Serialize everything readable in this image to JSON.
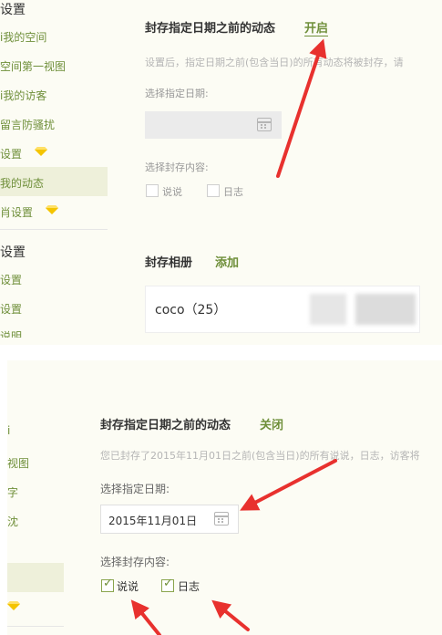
{
  "top": {
    "sidebar": {
      "header1": "设置",
      "items": [
        "i我的空间",
        "空间第一视图",
        "i我的访客",
        "留言防骚扰",
        "设置",
        "我的动态",
        "肖设置"
      ],
      "header2": "设置",
      "items2": [
        "设置",
        "设置",
        "说明"
      ]
    },
    "seal_title": "封存指定日期之前的动态",
    "toggle_label": "开启",
    "description": "设置后，指定日期之前(包含当日)的所有动态将被封存，请",
    "date_label": "选择指定日期:",
    "content_label": "选择封存内容:",
    "options": [
      "说说",
      "日志"
    ],
    "album_title": "封存相册",
    "album_add": "添加",
    "album_item": "coco（25）"
  },
  "bottom": {
    "sidebar": {
      "items": [
        "i",
        "视图",
        "字",
        "沈",
        "",
        ""
      ]
    },
    "seal_title": "封存指定日期之前的动态",
    "toggle_label": "关闭",
    "description": "您已封存了2015年11月01日之前(包含当日)的所有说说，日志，访客将",
    "date_label": "选择指定日期:",
    "date_value": "2015年11月01日",
    "content_label": "选择封存内容:",
    "options": [
      "说说",
      "日志"
    ]
  },
  "icons": {
    "calendar": "calendar-icon",
    "vip": "diamond-icon",
    "arrow": "red-arrow"
  },
  "colors": {
    "accent": "#6f8f3a",
    "arrow": "#e8312e",
    "panel": "#fcfcf4"
  }
}
